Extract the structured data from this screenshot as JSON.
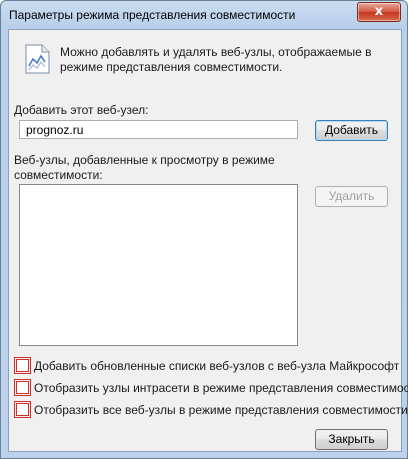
{
  "window": {
    "title": "Параметры режима представления совместимости",
    "close_glyph": "x"
  },
  "info": {
    "icon": "compatibility-view-icon",
    "text": "Можно добавлять и удалять веб-узлы, отображаемые в режиме представления совместимости."
  },
  "add_site": {
    "label": "Добавить этот веб-узел:",
    "value": "prognoz.ru",
    "button_label": "Добавить"
  },
  "site_list": {
    "label": "Веб-узлы, добавленные к просмотру в режиме совместимости:",
    "items": [],
    "remove_button_label": "Удалить"
  },
  "options": [
    {
      "label": "Добавить обновленные списки веб-узлов с веб-узла Майкрософт",
      "checked": false
    },
    {
      "label": "Отобразить узлы интрасети в режиме представления совместимости",
      "checked": false
    },
    {
      "label": "Отобразить все веб-узлы в режиме представления совместимости",
      "checked": false
    }
  ],
  "footer": {
    "close_label": "Закрыть"
  },
  "colors": {
    "highlight_border": "#d0302a",
    "title_gradient": "#c9dcf1",
    "client_bg": "#f0f0f0"
  }
}
